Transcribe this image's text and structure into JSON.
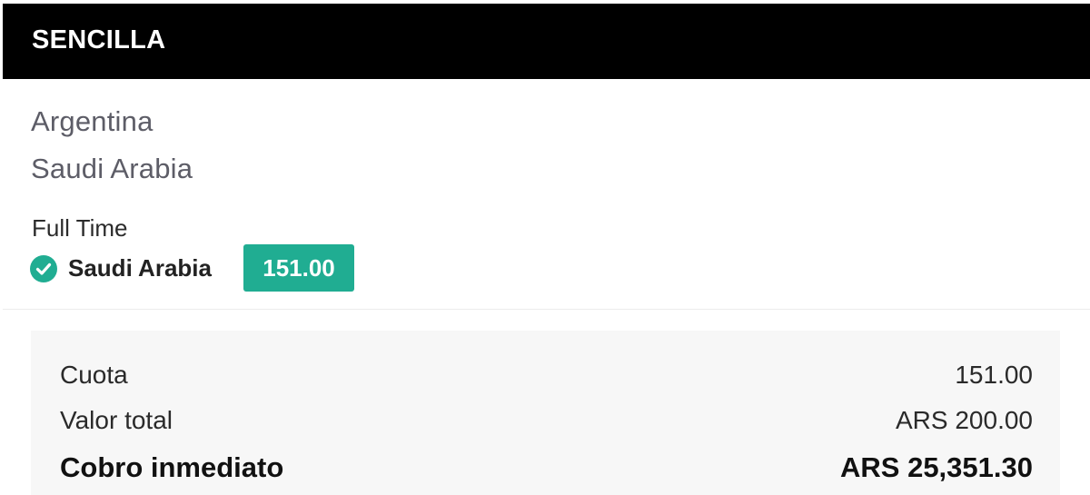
{
  "bet": {
    "type_label": "SENCILLA",
    "teams": {
      "home": "Argentina",
      "away": "Saudi Arabia"
    },
    "market": "Full Time",
    "selection": {
      "name": "Saudi Arabia",
      "odds": "151.00",
      "status_icon": "check-circle-icon",
      "status_color": "#20ad92"
    }
  },
  "summary": {
    "odds_label": "Cuota",
    "odds_value": "151.00",
    "total_label": "Valor total",
    "total_value": "ARS 200.00",
    "payout_label": "Cobro inmediato",
    "payout_value": "ARS 25,351.30"
  },
  "colors": {
    "header_bg": "#000000",
    "accent": "#20ad92",
    "summary_bg": "#f7f7f7"
  }
}
